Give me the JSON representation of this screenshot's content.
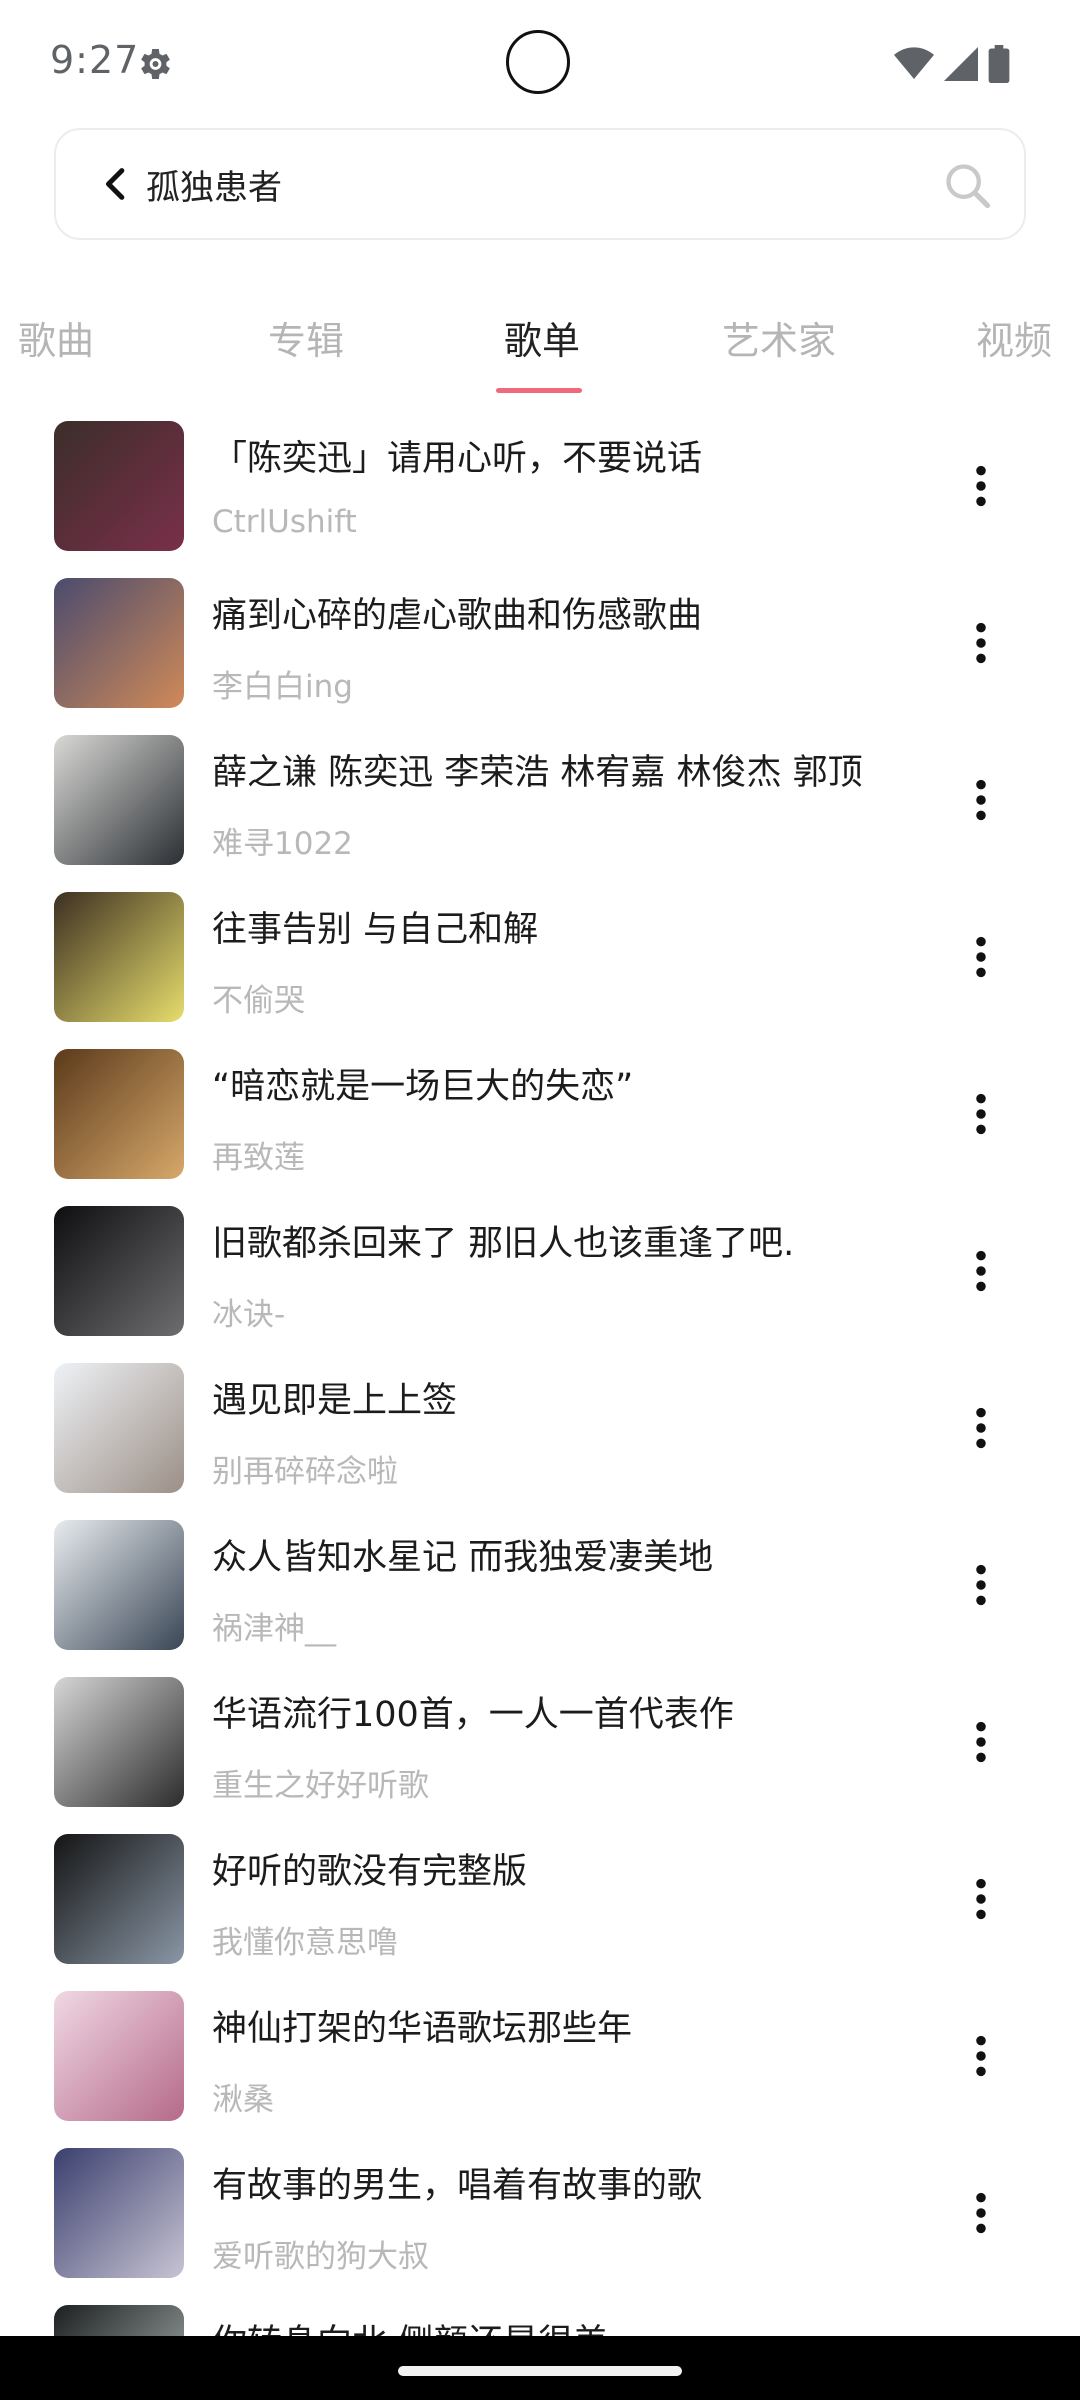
{
  "status_bar": {
    "time": "9:27"
  },
  "search": {
    "query": "孤独患者"
  },
  "tabs": [
    {
      "label": "歌曲",
      "active": false
    },
    {
      "label": "专辑",
      "active": false
    },
    {
      "label": "歌单",
      "active": true
    },
    {
      "label": "艺术家",
      "active": false
    },
    {
      "label": "视频",
      "active": false
    }
  ],
  "playlists": [
    {
      "title": "「陈奕迅」请用心听，不要说话",
      "author": "CtrlUshift",
      "cover_colors": [
        "#3b2e2a",
        "#7a2f4a"
      ]
    },
    {
      "title": "痛到心碎的虐心歌曲和伤感歌曲",
      "author": "李白白ing",
      "cover_colors": [
        "#4a4b6e",
        "#d08a58"
      ]
    },
    {
      "title": "薛之谦 陈奕迅 李荣浩 林宥嘉 林俊杰 郭顶",
      "author": "难寻1022",
      "cover_colors": [
        "#d9d9d6",
        "#2b2f33"
      ]
    },
    {
      "title": "往事告别 与自己和解",
      "author": "不偷哭",
      "cover_colors": [
        "#3c2f22",
        "#e7dd6c"
      ]
    },
    {
      "title": "“暗恋就是一场巨大的失恋”",
      "author": "再致莲",
      "cover_colors": [
        "#5b3a1b",
        "#d7a86a"
      ]
    },
    {
      "title": "旧歌都杀回来了 那旧人也该重逢了吧.",
      "author": "冰诀-",
      "cover_colors": [
        "#0e0e10",
        "#6d6d70"
      ]
    },
    {
      "title": "遇见即是上上签",
      "author": "别再碎碎念啦",
      "cover_colors": [
        "#eef2f6",
        "#9c8f86"
      ]
    },
    {
      "title": "众人皆知水星记 而我独爱凄美地",
      "author": "祸津神__",
      "cover_colors": [
        "#e8ecef",
        "#3a4656"
      ]
    },
    {
      "title": "华语流行100首，一人一首代表作",
      "author": "重生之好好听歌",
      "cover_colors": [
        "#d6d6d6",
        "#2c2c2c"
      ]
    },
    {
      "title": "好听的歌没有完整版",
      "author": "我懂你意思噜",
      "cover_colors": [
        "#141414",
        "#8a97a6"
      ]
    },
    {
      "title": "神仙打架的华语歌坛那些年",
      "author": "湫桑",
      "cover_colors": [
        "#f0d8e4",
        "#b56a8a"
      ]
    },
    {
      "title": "有故事的男生，唱着有故事的歌",
      "author": "爱听歌的狗大叔",
      "cover_colors": [
        "#3a3f6e",
        "#c8c4d4"
      ]
    },
    {
      "title": "你转身向北 侧颜还是很美",
      "author": "",
      "cover_colors": [
        "#1c1f20",
        "#b7c2c0"
      ]
    }
  ],
  "colors": {
    "accent": "#f06a7d",
    "subtitle": "#b8b8b8"
  }
}
